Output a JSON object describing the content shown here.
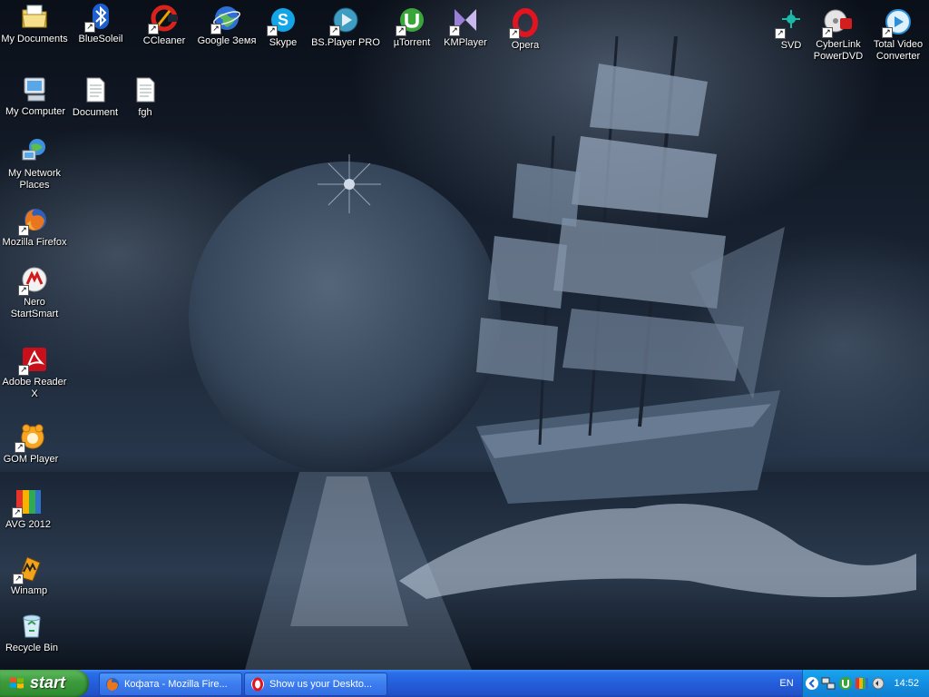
{
  "desktop_icons_left": [
    {
      "label": "My Documents",
      "icon": "my-documents-icon"
    },
    {
      "label": "My Computer",
      "icon": "my-computer-icon"
    },
    {
      "label": "My Network Places",
      "icon": "network-places-icon"
    },
    {
      "label": "Mozilla Firefox",
      "icon": "firefox-icon"
    },
    {
      "label": "Nero StartSmart",
      "icon": "nero-icon"
    },
    {
      "label": "Adobe Reader X",
      "icon": "adobe-reader-icon"
    },
    {
      "label": "GOM Player",
      "icon": "gom-player-icon"
    },
    {
      "label": "AVG 2012",
      "icon": "avg-icon"
    },
    {
      "label": "Winamp",
      "icon": "winamp-icon"
    },
    {
      "label": "Recycle Bin",
      "icon": "recycle-bin-icon"
    }
  ],
  "desktop_icons_top": [
    {
      "label": "BlueSoleil",
      "icon": "bluetooth-icon"
    },
    {
      "label": "CCleaner",
      "icon": "ccleaner-icon"
    },
    {
      "label": "Google Земя",
      "icon": "google-earth-icon"
    },
    {
      "label": "Skype",
      "icon": "skype-icon"
    },
    {
      "label": "BS.Player PRO",
      "icon": "bsplayer-icon"
    },
    {
      "label": "µTorrent",
      "icon": "utorrent-icon"
    },
    {
      "label": "KMPlayer",
      "icon": "kmplayer-icon"
    },
    {
      "label": "Opera",
      "icon": "opera-icon"
    }
  ],
  "desktop_icons_row2": [
    {
      "label": "Document",
      "icon": "document-icon"
    },
    {
      "label": "fgh",
      "icon": "document-icon"
    }
  ],
  "desktop_icons_right": [
    {
      "label": "SVD",
      "icon": "svd-icon"
    },
    {
      "label": "CyberLink PowerDVD",
      "icon": "powerdvd-icon"
    },
    {
      "label": "Total Video Converter",
      "icon": "video-converter-icon"
    }
  ],
  "taskbar": {
    "start_label": "start",
    "tasks": [
      {
        "label": "Кофата - Mozilla Fire...",
        "icon": "firefox-icon"
      },
      {
        "label": "Show us your Deskto...",
        "icon": "opera-icon"
      }
    ],
    "language": "EN",
    "clock": "14:52"
  }
}
